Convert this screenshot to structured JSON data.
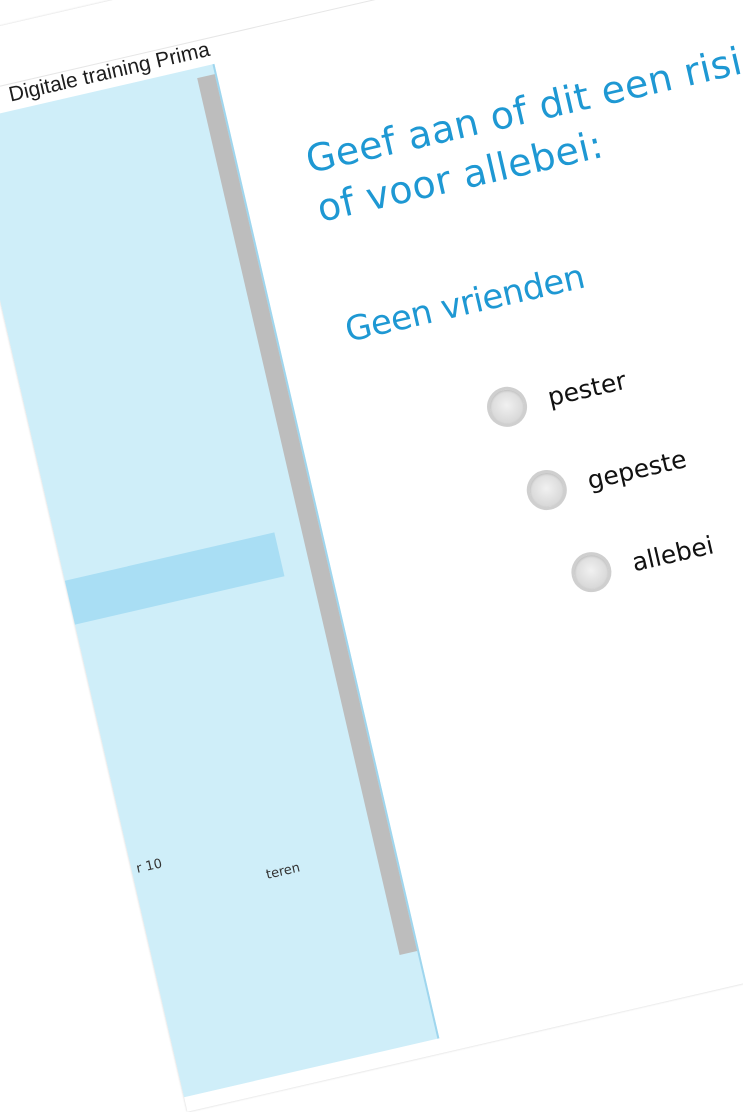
{
  "app": {
    "title": "Digitale training Prima"
  },
  "question": {
    "prompt": "Geef aan of dit een risicofact gepeste of voor allebei:",
    "topic": "Geen vrienden"
  },
  "options": [
    {
      "label": "pester"
    },
    {
      "label": "gepeste"
    },
    {
      "label": "allebei"
    }
  ],
  "sidebar": {
    "items": [
      {
        "label": "r 10"
      },
      {
        "label": "teren"
      }
    ]
  },
  "colors": {
    "accent": "#1e98d3",
    "sidebar_bg": "#cfeef9",
    "sidebar_active": "#a9def4"
  }
}
